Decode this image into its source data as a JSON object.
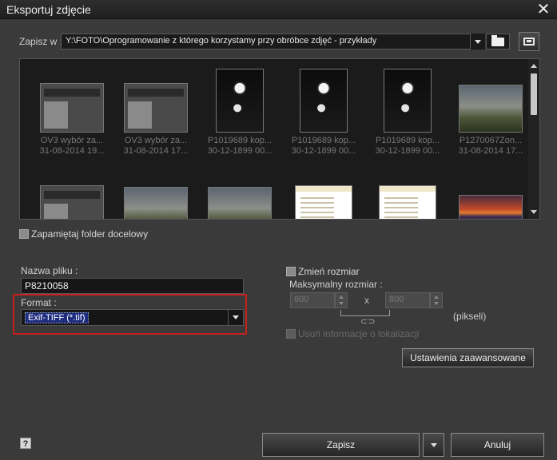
{
  "window": {
    "title": "Eksportuj zdjęcie"
  },
  "save_in": {
    "label": "Zapisz w :",
    "path": "Y:\\FOTO\\Oprogramowanie z którego korzystamy przy obróbce zdjęć - przykłady"
  },
  "thumbnails": [
    {
      "name": "OV3 wybór za...",
      "date": "31-08-2014 19...",
      "kind": "ui"
    },
    {
      "name": "OV3 wybór za...",
      "date": "31-08-2014 17...",
      "kind": "ui"
    },
    {
      "name": "P1019689 kop...",
      "date": "30-12-1899 00...",
      "kind": "flower"
    },
    {
      "name": "P1019689 kop...",
      "date": "30-12-1899 00...",
      "kind": "flower"
    },
    {
      "name": "P1019689 kop...",
      "date": "30-12-1899 00...",
      "kind": "flower"
    },
    {
      "name": "P1270067Zon...",
      "date": "31-08-2014 17...",
      "kind": "sky"
    },
    {
      "name": "",
      "date": "",
      "kind": "ui"
    },
    {
      "name": "",
      "date": "",
      "kind": "sky"
    },
    {
      "name": "",
      "date": "",
      "kind": "sky"
    },
    {
      "name": "",
      "date": "",
      "kind": "doc"
    },
    {
      "name": "",
      "date": "",
      "kind": "doc"
    },
    {
      "name": "",
      "date": "",
      "kind": "sunset"
    }
  ],
  "remember_folder": {
    "label": "Zapamiętaj folder docelowy"
  },
  "filename": {
    "label": "Nazwa pliku :",
    "value": "P8210058"
  },
  "format": {
    "label": "Format :",
    "value": "Exif-TIFF (*.tif)"
  },
  "resize": {
    "label": "Zmień rozmiar",
    "max_label": "Maksymalny rozmiar :",
    "width": "800",
    "height": "800",
    "times": "x",
    "unit": "(pikseli)",
    "link": "⊂⊃"
  },
  "remove_location": {
    "label": "Usuń informacje o lokalizacji"
  },
  "advanced_button": {
    "label": "Ustawienia zaawansowane"
  },
  "help": {
    "label": "?"
  },
  "save_button": {
    "label": "Zapisz"
  },
  "cancel_button": {
    "label": "Anuluj"
  },
  "close_glyph": "✕"
}
